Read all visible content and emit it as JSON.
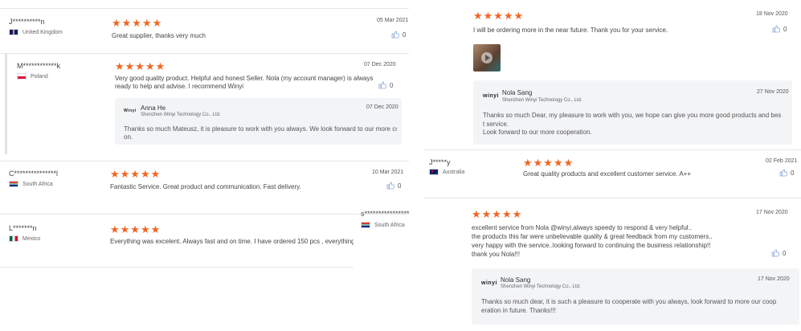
{
  "left": {
    "reviews": [
      {
        "name": "J**********n",
        "country": "United Kingdom",
        "date": "05 Mar 2021",
        "stars": "★★★★★",
        "lines": [
          "Great supplier,  thanks very much"
        ],
        "likes": "0"
      },
      {
        "name": "M************k",
        "country": "Poland",
        "date": "07 Dec 2020",
        "stars": "★★★★★",
        "lines": [
          "Very good quality product. Helpful and honest Seller. Nola (my account manager) is always",
          "ready to help and advise. I recommend Winyi"
        ],
        "likes": "0",
        "reply": {
          "logo": "Winyi",
          "name": "Anna He",
          "company": "Shenzhen Winyi Technology Co., Ltd.",
          "date": "07 Dec 2020",
          "lines": [
            "Thanks so much Mateusz, it is pleasure to work with you always. We look forward to our more cooperati",
            "on."
          ]
        }
      },
      {
        "name": "C***************l",
        "country": "South Africa",
        "date": "10 Mar 2021",
        "stars": "★★★★★",
        "lines": [
          "Fantastic Service. Great product and communication. Fast delivery."
        ],
        "likes": "0"
      },
      {
        "name": "L*******n",
        "country": "Mexico",
        "stars": "★★★★★",
        "lines": [
          "Everything was excelent. Always fast and on time. I have ordered 150 pcs , everything goo"
        ]
      }
    ],
    "floating": {
      "name": "s****************",
      "country": "South Africa"
    }
  },
  "right": {
    "reviews": [
      {
        "date": "18 Nov 2020",
        "stars": "★★★★★",
        "lines": [
          "I will be ordering more in the near future. Thank you for your service."
        ],
        "likes": "0",
        "reply": {
          "logo": "winyi",
          "name": "Nola Sang",
          "company": "Shenzhen Winyi Technology Co., Ltd.",
          "date": "27 Nov 2020",
          "lines": [
            "Thanks so much Dear, my pleasure to work with you, we hope can give you more good products and bes",
            "t service.",
            "Look forward to our more cooperation."
          ]
        }
      },
      {
        "name": "J*****y",
        "country": "Australia",
        "date": "02 Feb 2021",
        "stars": "★★★★★",
        "lines": [
          "Great quality products and excellent customer service. A++"
        ],
        "likes": "0"
      },
      {
        "date": "17 Nov 2020",
        "stars": "★★★★★",
        "lines": [
          "excellent service from Nola @winyi,always speedy to respond & very helpful..",
          "the products this far were unbelievable quality & great feedback from my customers..",
          "very happy with the service..looking forward to continuing the business relationship!!",
          "thank you Nola!!!"
        ],
        "likes": "0",
        "reply": {
          "logo": "winyi",
          "name": "Nola Sang",
          "company": "Shenzhen Winyi Technology Co., Ltd.",
          "date": "17 Nov 2020",
          "lines": [
            "Thanks so much dear, it is such a pleasure to cooperate with you always, look forward to more our coop",
            "eration in future. Thanks!!!"
          ]
        }
      }
    ]
  },
  "colors": {
    "star": "#f26522",
    "divider": "#e6e6e6",
    "reply_bg": "#f3f4f6"
  },
  "icons": [
    "thumbs-up-icon",
    "play-icon",
    "flag-icon"
  ]
}
